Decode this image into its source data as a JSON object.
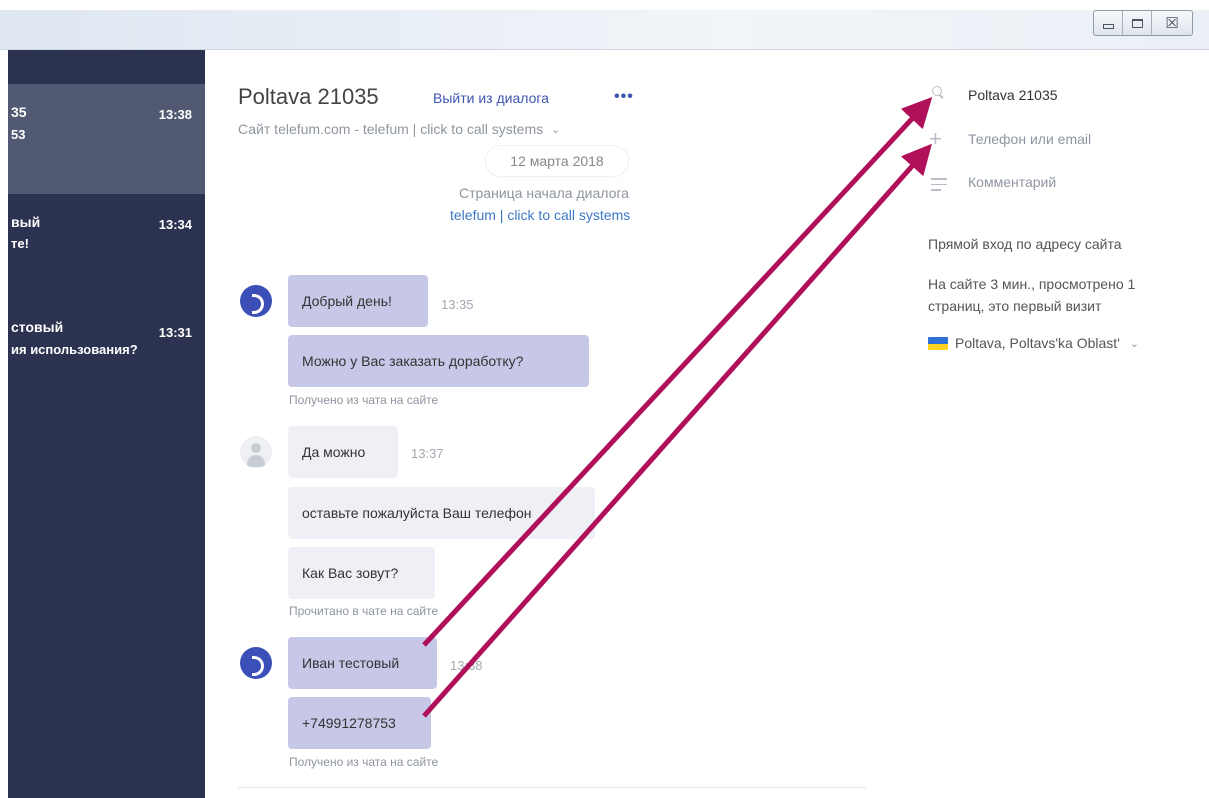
{
  "window": {
    "controls": {
      "minimize_icon": "minimize-icon",
      "maximize_icon": "maximize-icon",
      "close_icon": "close-icon",
      "close_glyph": "☒"
    }
  },
  "sidebar": {
    "conversations": [
      {
        "name": "35",
        "preview": "53",
        "time": "13:38",
        "active": true
      },
      {
        "name": "вый",
        "preview": "те!",
        "time": "13:34",
        "active": false
      },
      {
        "name": "стовый",
        "preview": "ия использования?",
        "time": "13:31",
        "active": false
      }
    ]
  },
  "chat": {
    "title": "Poltava 21035",
    "leave_label": "Выйти из диалога",
    "more_glyph": "•••",
    "site_line": "Сайт telefum.com - telefum | click to call systems",
    "date": "12 марта 2018",
    "start_page_label": "Страница начала диалога",
    "start_page_link": "telefum | click to call systems",
    "messages": {
      "m1_text": "Добрый день!",
      "m1_time": "13:35",
      "m2_text": "Можно у Вас заказать доработку?",
      "note1": "Получено из чата на сайте",
      "m3_text": "Да можно",
      "m3_time": "13:37",
      "m4_text": "оставьте пожалуйста Ваш телефон",
      "m5_text": "Как Вас зовут?",
      "note2": "Прочитано в чате на сайте",
      "m6_text": "Иван тестовый",
      "m6_time": "13:38",
      "m7_text": "+74991278753",
      "note3": "Получено из чата на сайте"
    }
  },
  "details": {
    "name": "Poltava 21035",
    "phone_placeholder": "Телефон или email",
    "comment_placeholder": "Комментарий",
    "entry": "Прямой вход по адресу сайта",
    "visit_line1": "На сайте 3 мин., просмотрено 1",
    "visit_line2": "страниц, это первый визит",
    "location": "Poltava, Poltavs'ka Oblast'",
    "flag_colors": [
      "#2f6fd6",
      "#ffd21f"
    ]
  },
  "colors": {
    "sidebar_bg": "#2c3350",
    "sidebar_active": "#515a72",
    "operator_bubble": "#c7c8e8",
    "visitor_bubble": "#eef0f6",
    "accent_link": "#3d56b2",
    "annotation_arrow": "#b0105a"
  }
}
